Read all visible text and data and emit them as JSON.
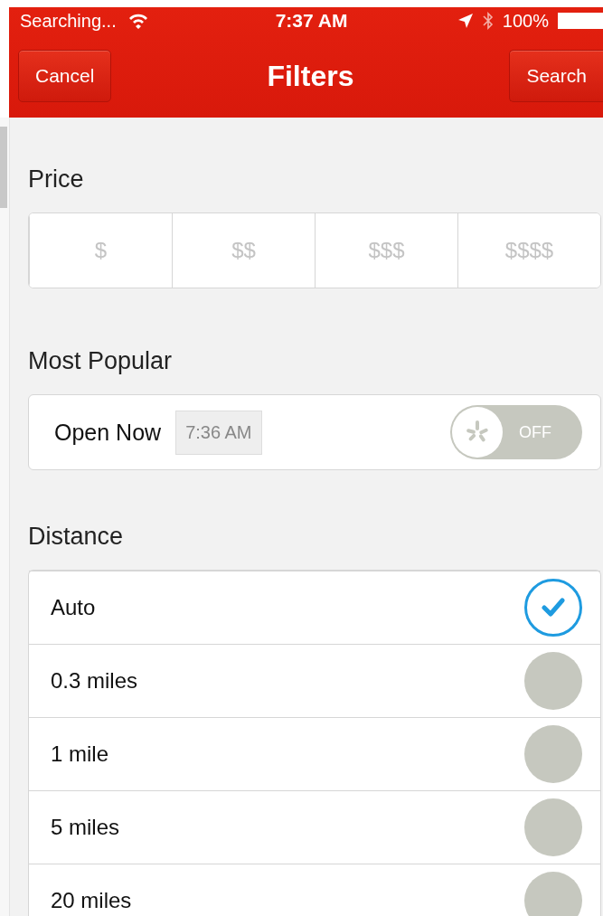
{
  "status_bar": {
    "carrier": "Searching...",
    "time": "7:37 AM",
    "battery": "100%"
  },
  "nav": {
    "cancel": "Cancel",
    "title": "Filters",
    "search": "Search"
  },
  "price": {
    "label": "Price",
    "options": [
      {
        "label": "$",
        "selected": false
      },
      {
        "label": "$$",
        "selected": false
      },
      {
        "label": "$$$",
        "selected": false
      },
      {
        "label": "$$$$",
        "selected": false
      }
    ]
  },
  "most_popular": {
    "label": "Most Popular",
    "open_now": {
      "label": "Open Now",
      "time": "7:36 AM",
      "toggle": {
        "on": false,
        "label": "OFF"
      }
    }
  },
  "distance": {
    "label": "Distance",
    "options": [
      {
        "label": "Auto",
        "selected": true
      },
      {
        "label": "0.3 miles",
        "selected": false
      },
      {
        "label": "1 mile",
        "selected": false
      },
      {
        "label": "5 miles",
        "selected": false
      },
      {
        "label": "20 miles",
        "selected": false
      }
    ]
  }
}
